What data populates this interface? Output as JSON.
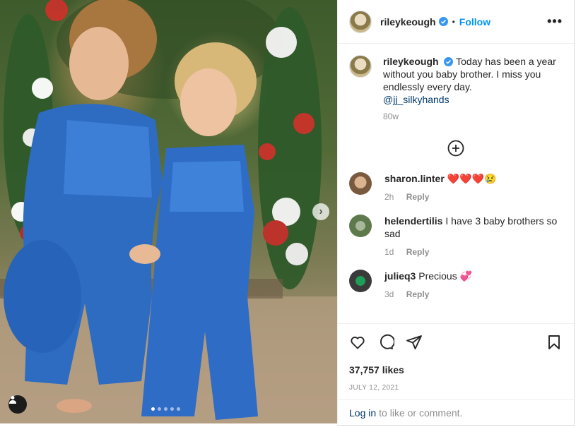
{
  "post": {
    "username": "rileykeough",
    "separator": "•",
    "follow_label": "Follow",
    "more_label": "•••",
    "caption_text": "Today has been a year without you baby brother. I miss you endlessly every day.",
    "caption_mention": "@jj_silkyhands",
    "caption_age": "80w",
    "likes": "37,757 likes",
    "date": "JULY 12, 2021",
    "carousel": {
      "slide_count": 5,
      "active_index": 0
    }
  },
  "comments": [
    {
      "user": "sharon.linter",
      "text": "❤️❤️❤️😢",
      "age": "2h",
      "reply_label": "Reply"
    },
    {
      "user": "helendertilis",
      "text": "I have 3 baby brothers so sad",
      "age": "1d",
      "reply_label": "Reply"
    },
    {
      "user": "julieq3",
      "text": "Precious 💞",
      "age": "3d",
      "reply_label": "Reply"
    }
  ],
  "footer": {
    "login_label": "Log in",
    "login_suffix": "to like or comment."
  },
  "colors": {
    "accent": "#0095f6",
    "verified": "#3897f0",
    "link": "#00376b"
  }
}
